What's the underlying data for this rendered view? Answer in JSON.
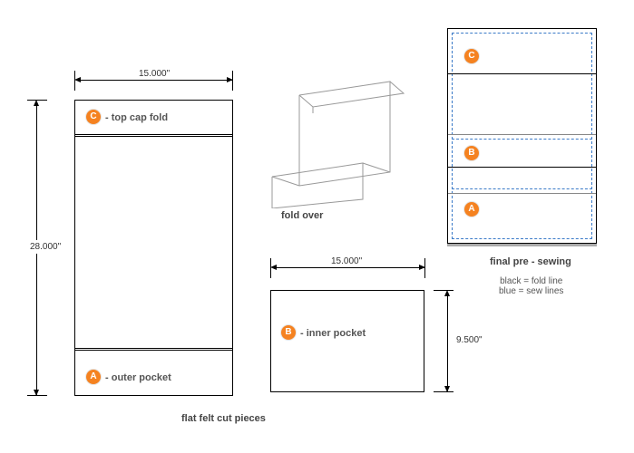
{
  "dims": {
    "main_width": "15.000\"",
    "main_height": "28.000\"",
    "pocket_width": "15.000\"",
    "pocket_height": "9.500\""
  },
  "badges": {
    "a": "A",
    "b": "B",
    "c": "C"
  },
  "labels": {
    "top_cap_fold": "- top cap fold",
    "outer_pocket": "- outer pocket",
    "inner_pocket": "- inner pocket"
  },
  "captions": {
    "flat": "flat felt cut pieces",
    "foldover": "fold over",
    "final": "final pre - sewing"
  },
  "legend": {
    "l1": "black = fold line",
    "l2": "blue = sew lines"
  }
}
